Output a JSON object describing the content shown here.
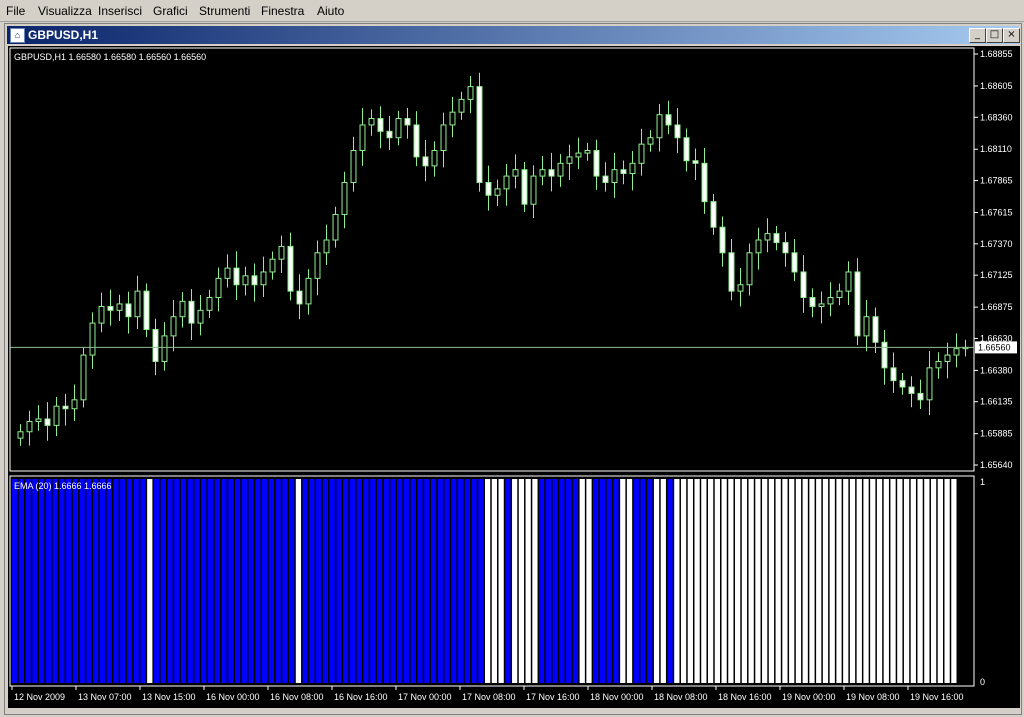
{
  "menu": [
    {
      "label": "File"
    },
    {
      "label": "Visualizza"
    },
    {
      "label": "Inserisci"
    },
    {
      "label": "Grafici"
    },
    {
      "label": "Strumenti"
    },
    {
      "label": "Finestra"
    },
    {
      "label": "Aiuto"
    }
  ],
  "window": {
    "title": "GBPUSD,H1",
    "buttons": [
      "_",
      "□",
      "×"
    ]
  },
  "colors": {
    "background": "#000000",
    "candle": "#90ee90",
    "indicator_up": "#0000ff",
    "indicator_down": "#ffffff",
    "price_line": "#8fbc8f",
    "text": "#ffffff"
  },
  "chart_data": [
    {
      "type": "candlestick",
      "title": "GBPUSD,H1",
      "ohlc_label": "1.66580 1.66580 1.66560 1.66560",
      "current_price": 1.6656,
      "current_price_label": "1.66560",
      "ylim": [
        1.6564,
        1.68855
      ],
      "y_ticks": [
        "1.68855",
        "1.68605",
        "1.68360",
        "1.68110",
        "1.67865",
        "1.67615",
        "1.67370",
        "1.67125",
        "1.66875",
        "1.66630",
        "1.66380",
        "1.66135",
        "1.65885",
        "1.65640"
      ],
      "x_ticks": [
        "12 Nov 2009",
        "13 Nov 07:00",
        "13 Nov 15:00",
        "16 Nov 00:00",
        "16 Nov 08:00",
        "16 Nov 16:00",
        "17 Nov 00:00",
        "17 Nov 08:00",
        "17 Nov 16:00",
        "18 Nov 00:00",
        "18 Nov 08:00",
        "18 Nov 16:00",
        "19 Nov 00:00",
        "19 Nov 08:00",
        "19 Nov 16:00"
      ],
      "close": [
        1.659,
        1.6598,
        1.66,
        1.6595,
        1.661,
        1.6608,
        1.6615,
        1.665,
        1.6675,
        1.6688,
        1.6685,
        1.669,
        1.668,
        1.67,
        1.667,
        1.6645,
        1.6665,
        1.668,
        1.6692,
        1.6675,
        1.6685,
        1.6695,
        1.671,
        1.6718,
        1.6705,
        1.6712,
        1.6705,
        1.6715,
        1.6725,
        1.6735,
        1.67,
        1.669,
        1.671,
        1.673,
        1.674,
        1.676,
        1.6785,
        1.681,
        1.683,
        1.6835,
        1.6825,
        1.682,
        1.6835,
        1.683,
        1.6805,
        1.6798,
        1.681,
        1.683,
        1.684,
        1.685,
        1.686,
        1.6785,
        1.6775,
        1.678,
        1.679,
        1.6795,
        1.6768,
        1.679,
        1.6795,
        1.679,
        1.68,
        1.6805,
        1.6808,
        1.681,
        1.679,
        1.6785,
        1.6795,
        1.6792,
        1.68,
        1.6815,
        1.682,
        1.6838,
        1.683,
        1.682,
        1.6802,
        1.68,
        1.677,
        1.675,
        1.673,
        1.67,
        1.6705,
        1.673,
        1.674,
        1.6745,
        1.6738,
        1.673,
        1.6715,
        1.6695,
        1.6688,
        1.669,
        1.6695,
        1.67,
        1.6715,
        1.6665,
        1.668,
        1.666,
        1.664,
        1.663,
        1.6625,
        1.662,
        1.6615,
        1.664,
        1.6645,
        1.665,
        1.6655,
        1.6656
      ],
      "ema_series": {
        "name": "EMA (20)",
        "label": "EMA (20)  1.6666 1.6666",
        "ylim": [
          0,
          1
        ],
        "y_ticks": [
          "1",
          "0"
        ],
        "state": [
          1,
          1,
          1,
          1,
          1,
          1,
          1,
          1,
          1,
          1,
          1,
          1,
          1,
          1,
          1,
          1,
          1,
          1,
          1,
          1,
          0,
          1,
          1,
          1,
          1,
          1,
          1,
          1,
          1,
          1,
          1,
          1,
          1,
          1,
          1,
          1,
          1,
          1,
          1,
          1,
          1,
          1,
          0,
          1,
          1,
          1,
          1,
          1,
          1,
          1,
          1,
          1,
          1,
          1,
          1,
          1,
          1,
          1,
          1,
          1,
          1,
          1,
          1,
          1,
          1,
          1,
          1,
          1,
          1,
          1,
          0,
          0,
          0,
          1,
          0,
          0,
          0,
          0,
          1,
          1,
          1,
          1,
          1,
          1,
          0,
          0,
          1,
          1,
          1,
          1,
          0,
          0,
          1,
          1,
          1,
          0,
          0,
          1,
          0,
          0,
          0,
          0,
          0,
          0,
          0,
          0,
          0,
          0,
          0,
          0,
          0,
          0,
          0,
          0,
          0,
          0,
          0,
          0,
          0,
          0,
          0,
          0,
          0,
          0,
          0,
          0,
          0,
          0,
          0,
          0,
          0,
          0,
          0,
          0,
          0,
          0,
          0,
          0,
          0,
          0
        ]
      }
    }
  ]
}
